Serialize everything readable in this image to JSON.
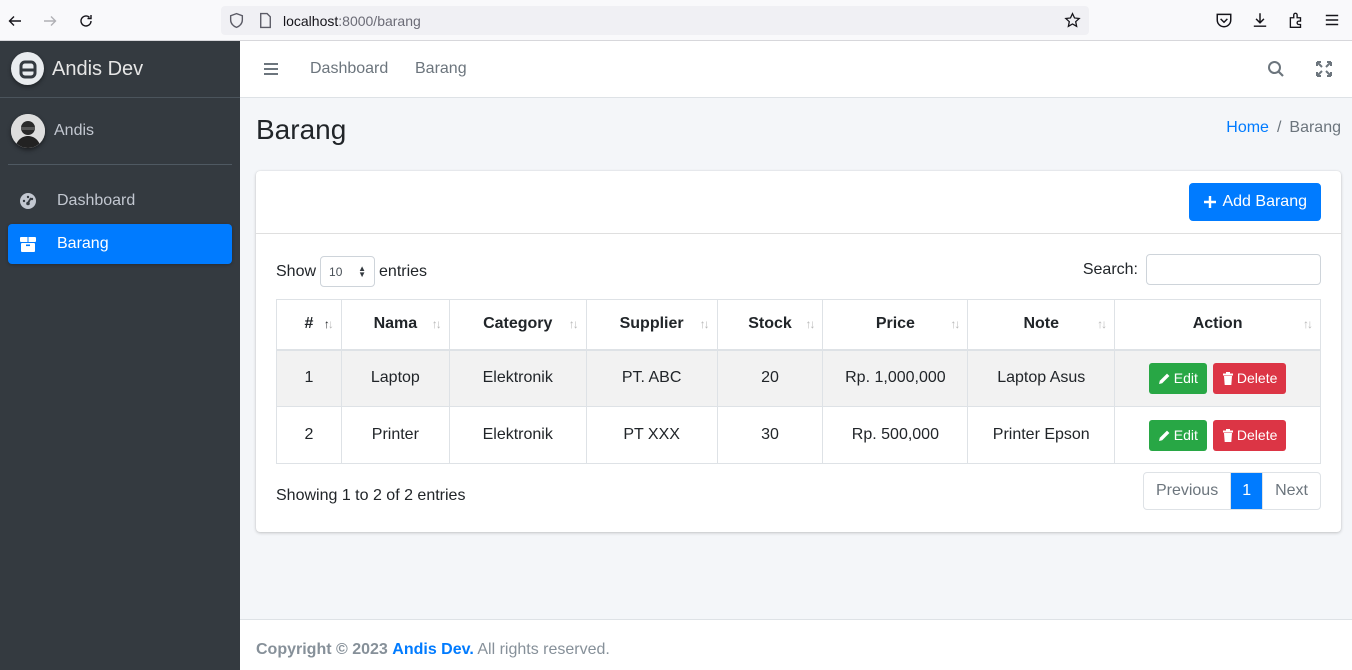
{
  "browser": {
    "url_host": "localhost",
    "url_rest": ":8000/barang"
  },
  "sidebar": {
    "brand": "Andis Dev",
    "user": "Andis",
    "items": [
      {
        "label": "Dashboard",
        "icon": "tachometer-icon",
        "active": false
      },
      {
        "label": "Barang",
        "icon": "box-icon",
        "active": true
      }
    ]
  },
  "topnav": {
    "links": [
      "Dashboard",
      "Barang"
    ]
  },
  "page": {
    "title": "Barang",
    "breadcrumb": {
      "home": "Home",
      "sep": "/",
      "current": "Barang"
    }
  },
  "card": {
    "add_button": "Add Barang",
    "show_label": "Show",
    "entries_label": "entries",
    "page_length": "10",
    "search_label": "Search:",
    "search_value": ""
  },
  "table": {
    "headers": [
      "#",
      "Nama",
      "Category",
      "Supplier",
      "Stock",
      "Price",
      "Note",
      "Action"
    ],
    "rows": [
      {
        "no": "1",
        "nama": "Laptop",
        "category": "Elektronik",
        "supplier": "PT. ABC",
        "stock": "20",
        "price": "Rp. 1,000,000",
        "note": "Laptop Asus"
      },
      {
        "no": "2",
        "nama": "Printer",
        "category": "Elektronik",
        "supplier": "PT XXX",
        "stock": "30",
        "price": "Rp. 500,000",
        "note": "Printer Epson"
      }
    ],
    "edit_label": "Edit",
    "delete_label": "Delete"
  },
  "footer_table": {
    "info": "Showing 1 to 2 of 2 entries",
    "prev": "Previous",
    "page": "1",
    "next": "Next"
  },
  "footer": {
    "copyright": "Copyright © 2023",
    "brand": "Andis Dev.",
    "rights": "All rights reserved."
  },
  "colors": {
    "primary": "#007bff",
    "success": "#28a745",
    "danger": "#dc3545",
    "sidebar": "#343a40"
  }
}
